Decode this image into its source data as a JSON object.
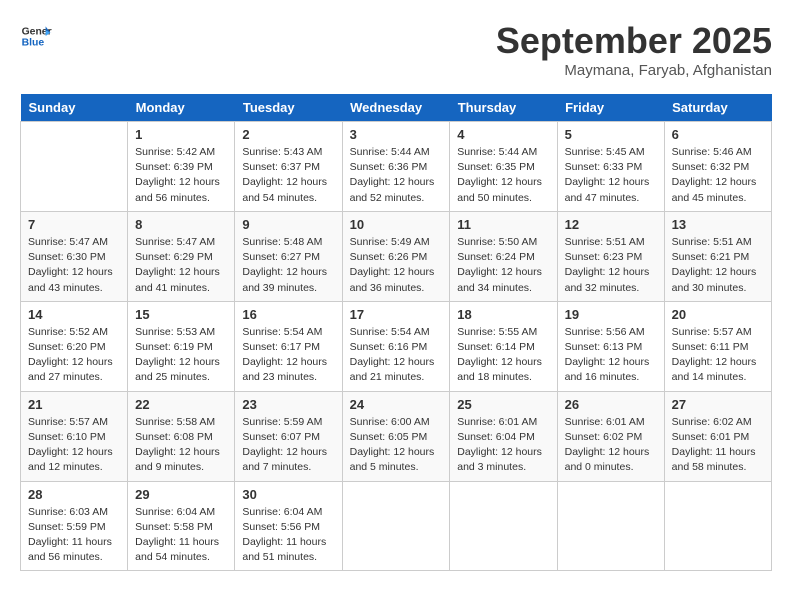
{
  "header": {
    "logo_general": "General",
    "logo_blue": "Blue",
    "month_title": "September 2025",
    "subtitle": "Maymana, Faryab, Afghanistan"
  },
  "weekdays": [
    "Sunday",
    "Monday",
    "Tuesday",
    "Wednesday",
    "Thursday",
    "Friday",
    "Saturday"
  ],
  "weeks": [
    [
      {
        "day": "",
        "info": ""
      },
      {
        "day": "1",
        "info": "Sunrise: 5:42 AM\nSunset: 6:39 PM\nDaylight: 12 hours\nand 56 minutes."
      },
      {
        "day": "2",
        "info": "Sunrise: 5:43 AM\nSunset: 6:37 PM\nDaylight: 12 hours\nand 54 minutes."
      },
      {
        "day": "3",
        "info": "Sunrise: 5:44 AM\nSunset: 6:36 PM\nDaylight: 12 hours\nand 52 minutes."
      },
      {
        "day": "4",
        "info": "Sunrise: 5:44 AM\nSunset: 6:35 PM\nDaylight: 12 hours\nand 50 minutes."
      },
      {
        "day": "5",
        "info": "Sunrise: 5:45 AM\nSunset: 6:33 PM\nDaylight: 12 hours\nand 47 minutes."
      },
      {
        "day": "6",
        "info": "Sunrise: 5:46 AM\nSunset: 6:32 PM\nDaylight: 12 hours\nand 45 minutes."
      }
    ],
    [
      {
        "day": "7",
        "info": "Sunrise: 5:47 AM\nSunset: 6:30 PM\nDaylight: 12 hours\nand 43 minutes."
      },
      {
        "day": "8",
        "info": "Sunrise: 5:47 AM\nSunset: 6:29 PM\nDaylight: 12 hours\nand 41 minutes."
      },
      {
        "day": "9",
        "info": "Sunrise: 5:48 AM\nSunset: 6:27 PM\nDaylight: 12 hours\nand 39 minutes."
      },
      {
        "day": "10",
        "info": "Sunrise: 5:49 AM\nSunset: 6:26 PM\nDaylight: 12 hours\nand 36 minutes."
      },
      {
        "day": "11",
        "info": "Sunrise: 5:50 AM\nSunset: 6:24 PM\nDaylight: 12 hours\nand 34 minutes."
      },
      {
        "day": "12",
        "info": "Sunrise: 5:51 AM\nSunset: 6:23 PM\nDaylight: 12 hours\nand 32 minutes."
      },
      {
        "day": "13",
        "info": "Sunrise: 5:51 AM\nSunset: 6:21 PM\nDaylight: 12 hours\nand 30 minutes."
      }
    ],
    [
      {
        "day": "14",
        "info": "Sunrise: 5:52 AM\nSunset: 6:20 PM\nDaylight: 12 hours\nand 27 minutes."
      },
      {
        "day": "15",
        "info": "Sunrise: 5:53 AM\nSunset: 6:19 PM\nDaylight: 12 hours\nand 25 minutes."
      },
      {
        "day": "16",
        "info": "Sunrise: 5:54 AM\nSunset: 6:17 PM\nDaylight: 12 hours\nand 23 minutes."
      },
      {
        "day": "17",
        "info": "Sunrise: 5:54 AM\nSunset: 6:16 PM\nDaylight: 12 hours\nand 21 minutes."
      },
      {
        "day": "18",
        "info": "Sunrise: 5:55 AM\nSunset: 6:14 PM\nDaylight: 12 hours\nand 18 minutes."
      },
      {
        "day": "19",
        "info": "Sunrise: 5:56 AM\nSunset: 6:13 PM\nDaylight: 12 hours\nand 16 minutes."
      },
      {
        "day": "20",
        "info": "Sunrise: 5:57 AM\nSunset: 6:11 PM\nDaylight: 12 hours\nand 14 minutes."
      }
    ],
    [
      {
        "day": "21",
        "info": "Sunrise: 5:57 AM\nSunset: 6:10 PM\nDaylight: 12 hours\nand 12 minutes."
      },
      {
        "day": "22",
        "info": "Sunrise: 5:58 AM\nSunset: 6:08 PM\nDaylight: 12 hours\nand 9 minutes."
      },
      {
        "day": "23",
        "info": "Sunrise: 5:59 AM\nSunset: 6:07 PM\nDaylight: 12 hours\nand 7 minutes."
      },
      {
        "day": "24",
        "info": "Sunrise: 6:00 AM\nSunset: 6:05 PM\nDaylight: 12 hours\nand 5 minutes."
      },
      {
        "day": "25",
        "info": "Sunrise: 6:01 AM\nSunset: 6:04 PM\nDaylight: 12 hours\nand 3 minutes."
      },
      {
        "day": "26",
        "info": "Sunrise: 6:01 AM\nSunset: 6:02 PM\nDaylight: 12 hours\nand 0 minutes."
      },
      {
        "day": "27",
        "info": "Sunrise: 6:02 AM\nSunset: 6:01 PM\nDaylight: 11 hours\nand 58 minutes."
      }
    ],
    [
      {
        "day": "28",
        "info": "Sunrise: 6:03 AM\nSunset: 5:59 PM\nDaylight: 11 hours\nand 56 minutes."
      },
      {
        "day": "29",
        "info": "Sunrise: 6:04 AM\nSunset: 5:58 PM\nDaylight: 11 hours\nand 54 minutes."
      },
      {
        "day": "30",
        "info": "Sunrise: 6:04 AM\nSunset: 5:56 PM\nDaylight: 11 hours\nand 51 minutes."
      },
      {
        "day": "",
        "info": ""
      },
      {
        "day": "",
        "info": ""
      },
      {
        "day": "",
        "info": ""
      },
      {
        "day": "",
        "info": ""
      }
    ]
  ]
}
